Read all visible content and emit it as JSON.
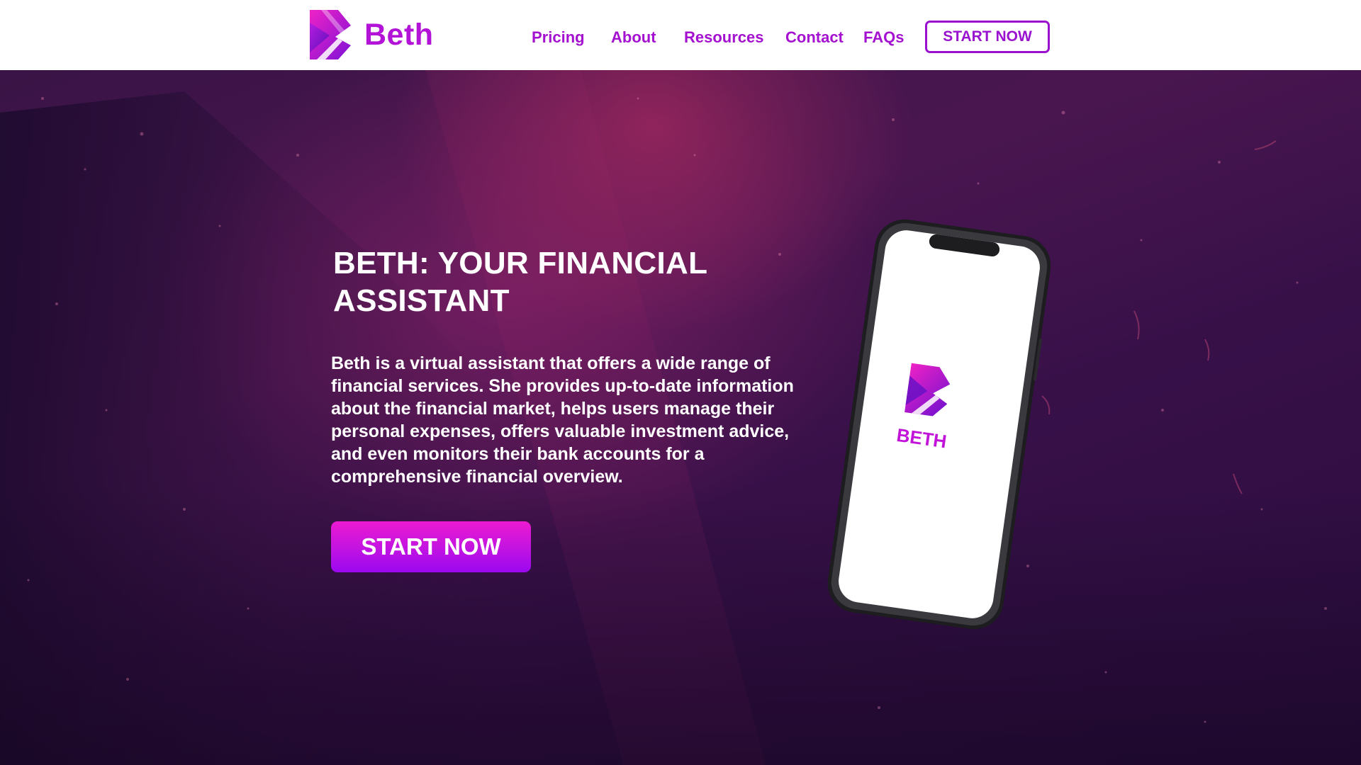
{
  "brand": {
    "name": "Beth",
    "logo_icon": "beth-b-logo-icon"
  },
  "nav": {
    "items": [
      {
        "label": "Pricing"
      },
      {
        "label": "About"
      },
      {
        "label": "Resources"
      },
      {
        "label": "Contact"
      },
      {
        "label": "FAQs"
      }
    ],
    "cta_label": "START NOW"
  },
  "hero": {
    "title": "BETH: YOUR FINANCIAL ASSISTANT",
    "description": "Beth is a virtual assistant that offers a wide range of financial services. She provides up-to-date information about the financial market, helps users manage their personal expenses, offers valuable investment advice, and even monitors their bank accounts for a comprehensive financial overview.",
    "cta_label": "START NOW",
    "phone_app_name": "BETH"
  },
  "colors": {
    "brand_purple": "#a411d0",
    "cta_gradient_top": "#ec1ad0",
    "cta_gradient_bottom": "#9b08f0",
    "hero_background": "#3a1446"
  }
}
